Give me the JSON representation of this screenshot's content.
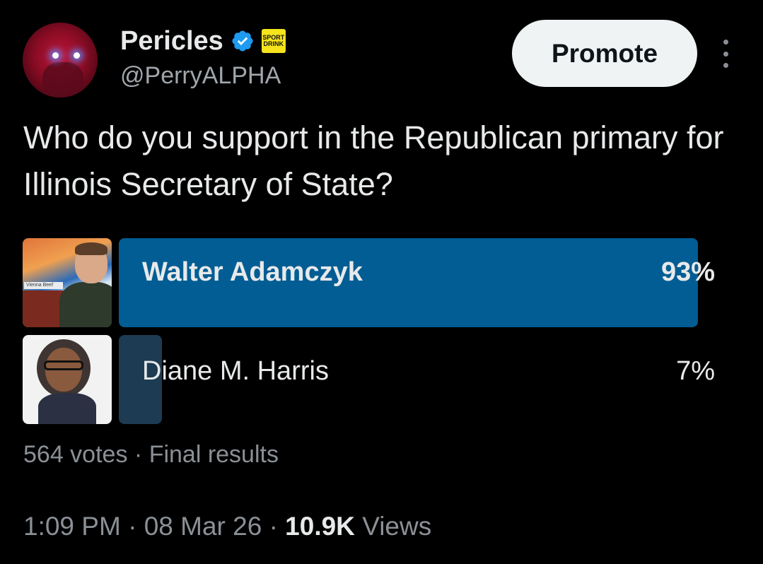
{
  "author": {
    "display_name": "Pericles",
    "handle": "@PerryALPHA",
    "verified": true,
    "affiliate_badge_text": "SPORT DRINK"
  },
  "actions": {
    "promote_label": "Promote",
    "more_icon": "more-vertical-icon"
  },
  "tweet": {
    "text": "Who do you support in the Republican primary for Illinois Secretary of State?"
  },
  "poll": {
    "options": [
      {
        "label": "Walter Adamczyk",
        "percent_text": "93%",
        "percent": 93,
        "winner": true
      },
      {
        "label": "Diane M. Harris",
        "percent_text": "7%",
        "percent": 7,
        "winner": false
      }
    ],
    "votes": "564 votes",
    "separator": "·",
    "status": "Final results"
  },
  "meta": {
    "time": "1:09 PM",
    "date": "08 Mar 26",
    "separator": "·",
    "views_count": "10.9K",
    "views_label": "Views"
  },
  "colors": {
    "background": "#000000",
    "winner_bar": "#015d93",
    "loser_bar": "#1d3b52",
    "verified": "#1d9bf0"
  }
}
